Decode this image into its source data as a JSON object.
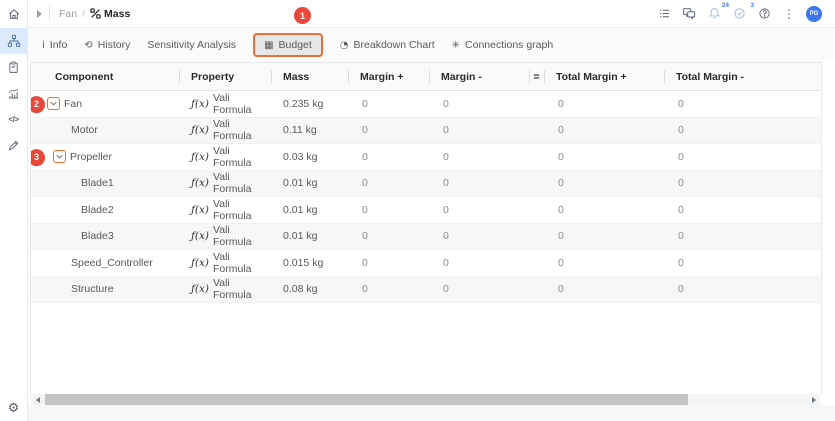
{
  "topbar": {
    "breadcrumb": {
      "parent": "Fan",
      "separator": "/",
      "current": "Mass"
    },
    "notifications_badge": "24",
    "approvals_badge": "3",
    "avatar_initials": "PG"
  },
  "sidebar": {
    "items": [
      {
        "icon": "home-icon",
        "active": false
      },
      {
        "icon": "product-tree-icon",
        "active": true
      },
      {
        "icon": "clipboard-icon",
        "active": false
      },
      {
        "icon": "analytics-icon",
        "active": false
      },
      {
        "icon": "code-icon",
        "active": false
      },
      {
        "icon": "edit-pen-icon",
        "active": false
      }
    ],
    "bottom_icon": "settings-gear-icon"
  },
  "tabs": [
    {
      "label": "Info",
      "icon": "info-icon",
      "active": false
    },
    {
      "label": "History",
      "icon": "history-icon",
      "active": false
    },
    {
      "label": "Sensitivity Analysis",
      "icon": null,
      "active": false
    },
    {
      "label": "Budget",
      "icon": "table-icon",
      "active": true
    },
    {
      "label": "Breakdown Chart",
      "icon": "pie-chart-icon",
      "active": false
    },
    {
      "label": "Connections graph",
      "icon": "asterisk-icon",
      "active": false
    }
  ],
  "table": {
    "columns": [
      "Component",
      "Property",
      "Mass",
      "Margin +",
      "Margin -",
      "=",
      "Total Margin +",
      "Total Margin -"
    ],
    "property_prefix": "ƒ(x)",
    "rows": [
      {
        "component": "Fan",
        "level": 0,
        "expandable": true,
        "annotation": "2",
        "property": "Vali Formula",
        "mass": "0.235 kg",
        "margin_plus": "0",
        "margin_minus": "0",
        "total_margin_plus": "0",
        "total_margin_minus": "0"
      },
      {
        "component": "Motor",
        "level": 1,
        "expandable": false,
        "property": "Vali Formula",
        "mass": "0.11 kg",
        "margin_plus": "0",
        "margin_minus": "0",
        "total_margin_plus": "0",
        "total_margin_minus": "0"
      },
      {
        "component": "Propeller",
        "level": 1,
        "expandable": true,
        "annotation": "3",
        "property": "Vali Formula",
        "mass": "0.03 kg",
        "margin_plus": "0",
        "margin_minus": "0",
        "total_margin_plus": "0",
        "total_margin_minus": "0"
      },
      {
        "component": "Blade1",
        "level": 2,
        "expandable": false,
        "property": "Vali Formula",
        "mass": "0.01 kg",
        "margin_plus": "0",
        "margin_minus": "0",
        "total_margin_plus": "0",
        "total_margin_minus": "0"
      },
      {
        "component": "Blade2",
        "level": 2,
        "expandable": false,
        "property": "Vali Formula",
        "mass": "0.01 kg",
        "margin_plus": "0",
        "margin_minus": "0",
        "total_margin_plus": "0",
        "total_margin_minus": "0"
      },
      {
        "component": "Blade3",
        "level": 2,
        "expandable": false,
        "property": "Vali Formula",
        "mass": "0.01 kg",
        "margin_plus": "0",
        "margin_minus": "0",
        "total_margin_plus": "0",
        "total_margin_minus": "0"
      },
      {
        "component": "Speed_Controller",
        "level": 1,
        "expandable": false,
        "property": "Vali Formula",
        "mass": "0.015 kg",
        "margin_plus": "0",
        "margin_minus": "0",
        "total_margin_plus": "0",
        "total_margin_minus": "0"
      },
      {
        "component": "Structure",
        "level": 1,
        "expandable": false,
        "property": "Vali Formula",
        "mass": "0.08 kg",
        "margin_plus": "0",
        "margin_minus": "0",
        "total_margin_plus": "0",
        "total_margin_minus": "0"
      }
    ]
  },
  "annotations": {
    "step1": "1",
    "step2": "2",
    "step3": "3"
  },
  "colors": {
    "annotation_red": "#E8473C",
    "highlight_orange": "#ED6E33",
    "avatar_blue": "#3D77EE",
    "badge_blue": "#4A7AF0",
    "active_sidebar_bg": "#DCEBFB",
    "row_alt_bg": "#F7F7F8"
  }
}
